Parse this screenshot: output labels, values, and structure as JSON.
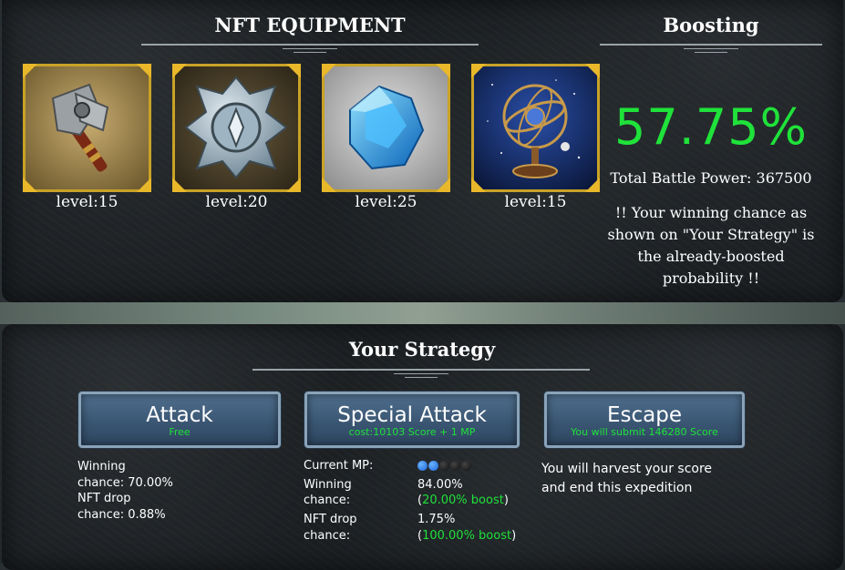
{
  "equipment": {
    "title": "NFT EQUIPMENT",
    "items": [
      {
        "name": "axe-icon",
        "level": "level:15"
      },
      {
        "name": "shield-icon",
        "level": "level:20"
      },
      {
        "name": "gem-icon",
        "level": "level:25"
      },
      {
        "name": "armillary-sphere-icon",
        "level": "level:15"
      }
    ]
  },
  "boosting": {
    "title": "Boosting",
    "percent": "57.75%",
    "total_battle_power": "Total Battle Power: 367500",
    "note": "!! Your winning chance as shown on \"Your Strategy\" is the already-boosted probability !!"
  },
  "strategy": {
    "title": "Your Strategy",
    "attack": {
      "label": "Attack",
      "sub": "Free",
      "winning_label": "Winning",
      "winning_value": "chance: 70.00%",
      "nft_label": "NFT drop",
      "nft_value": "chance: 0.88%"
    },
    "special": {
      "label": "Special Attack",
      "sub": "cost:10103 Score + 1 MP",
      "mp_label": "Current MP:",
      "mp_current": 2,
      "mp_max": 5,
      "winning_label_1": "Winning",
      "winning_label_2": "chance:",
      "winning_value": "84.00%",
      "winning_boost": "20.00% boost",
      "nft_label_1": "NFT drop",
      "nft_label_2": "chance:",
      "nft_value": "1.75%",
      "nft_boost": "100.00% boost"
    },
    "escape": {
      "label": "Escape",
      "sub": "You will submit 146280 Score",
      "desc_1": "You will harvest your score",
      "desc_2": "and end this expedition"
    }
  },
  "colors": {
    "accent_green": "#1fe23a",
    "gold_frame": "#e8b82a",
    "button_blue": "#3a5673"
  }
}
